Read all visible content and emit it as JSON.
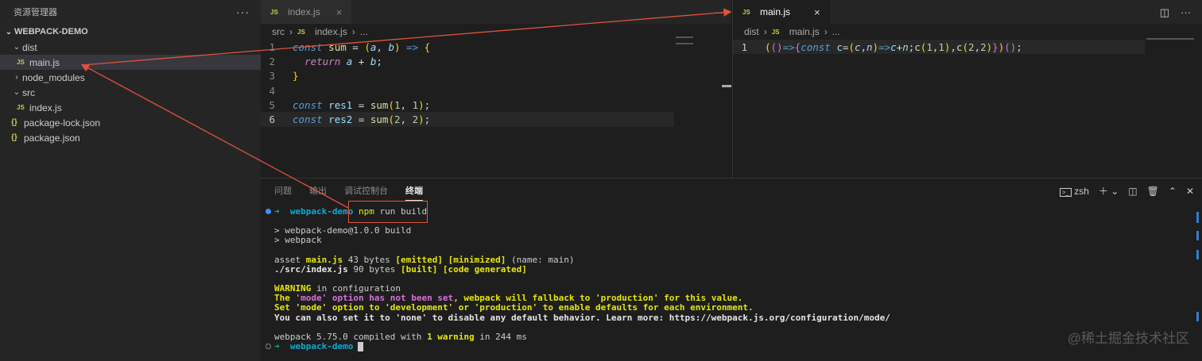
{
  "sidebar": {
    "title": "资源管理器",
    "more": "···",
    "project": "WEBPACK-DEMO",
    "items": [
      {
        "label": "dist",
        "type": "folder",
        "open": true
      },
      {
        "label": "main.js",
        "type": "js",
        "icon": "JS"
      },
      {
        "label": "node_modules",
        "type": "folder",
        "open": false
      },
      {
        "label": "src",
        "type": "folder",
        "open": true
      },
      {
        "label": "index.js",
        "type": "js",
        "icon": "JS"
      },
      {
        "label": "package-lock.json",
        "type": "json",
        "icon": "{}"
      },
      {
        "label": "package.json",
        "type": "json",
        "icon": "{}"
      }
    ]
  },
  "left_editor": {
    "tab": {
      "icon": "JS",
      "label": "index.js",
      "close": "×"
    },
    "more": "···",
    "breadcrumb": {
      "a": "src",
      "b": "index.js",
      "c": "..."
    },
    "lines": [
      "1",
      "2",
      "3",
      "4",
      "5",
      "6"
    ]
  },
  "right_editor": {
    "tab": {
      "icon": "JS",
      "label": "main.js",
      "close": "×"
    },
    "breadcrumb": {
      "a": "dist",
      "b": "main.js",
      "c": "..."
    },
    "line_no": "1"
  },
  "panel": {
    "tabs": [
      "问题",
      "输出",
      "调试控制台",
      "终端"
    ],
    "shell": "zsh",
    "terminal": {
      "prompt_dir": "webpack-demo",
      "command_npm": "npm",
      "command_rest": " run build",
      "l1": "> webpack-demo@1.0.0 build",
      "l2": "> webpack",
      "asset_a": "asset ",
      "asset_file": "main.js",
      "asset_b": " 43 bytes ",
      "asset_c": "[emitted] [minimized]",
      "asset_d": " (name: main)",
      "src_a": "./src/index.js",
      "src_b": " 90 bytes ",
      "src_c": "[built] [code generated]",
      "warn_a": "WARNING",
      "warn_b": " in configuration",
      "w1a": "The ",
      "w1b": "'mode' option has not been set",
      "w1c": ", webpack will fallback to 'production' for this value.",
      "w2": "Set 'mode' option to 'development' or 'production' to enable defaults for each environment.",
      "w3": "You can also set it to 'none' to disable any default behavior. Learn more: https://webpack.js.org/configuration/mode/",
      "done_a": "webpack 5.75.0 compiled with ",
      "done_b": "1 warning",
      "done_c": " in 244 ms"
    }
  },
  "watermark": "@稀土掘金技术社区",
  "colors": {
    "annotation": "#e0533b",
    "accent": "#3794ff"
  }
}
